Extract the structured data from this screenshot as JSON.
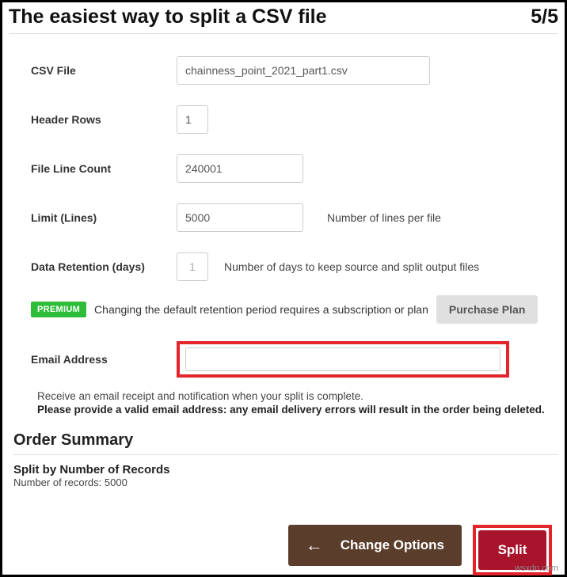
{
  "header": {
    "title": "The easiest way to split a CSV file",
    "step": "5/5"
  },
  "form": {
    "csv_file": {
      "label": "CSV File",
      "value": "chainness_point_2021_part1.csv"
    },
    "header_rows": {
      "label": "Header Rows",
      "value": "1"
    },
    "file_line_count": {
      "label": "File Line Count",
      "value": "240001"
    },
    "limit_lines": {
      "label": "Limit (Lines)",
      "value": "5000",
      "hint": "Number of lines per file"
    },
    "data_retention": {
      "label": "Data Retention (days)",
      "value": "1",
      "hint": "Number of days to keep source and split output files"
    },
    "premium": {
      "badge": "PREMIUM",
      "text": "Changing the default retention period requires a subscription or plan",
      "button": "Purchase Plan"
    },
    "email": {
      "label": "Email Address",
      "value": "",
      "note": "Receive an email receipt and notification when your split is complete.",
      "warn": "Please provide a valid email address: any email delivery errors will result in the order being deleted."
    }
  },
  "order": {
    "heading": "Order Summary",
    "title": "Split by Number of Records",
    "sub": "Number of records: 5000"
  },
  "actions": {
    "change": "Change Options",
    "split": "Split"
  },
  "watermark": "wsxdn.com"
}
